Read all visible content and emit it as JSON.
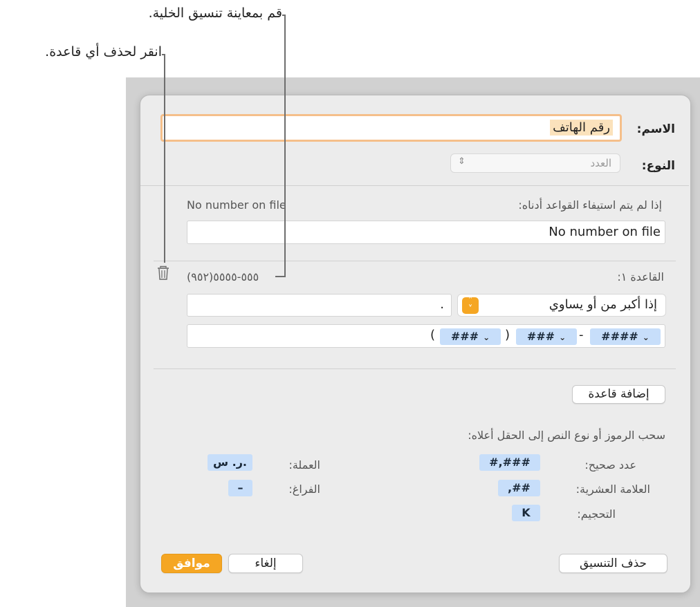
{
  "callouts": {
    "preview": "قم بمعاينة تنسيق الخلية.",
    "delete": "انقر لحذف أي قاعدة."
  },
  "dialog": {
    "name_label": "الاسم:",
    "name_value": "رقم الهاتف",
    "type_label": "النوع:",
    "type_value": "العدد",
    "fallback_label": "إذا لم يتم استيفاء القواعد أدناه:",
    "fallback_preview": "No number on file",
    "fallback_value": "No number on file",
    "rule_label": "القاعدة ١:",
    "rule_preview": "(٩٥٢)٥٥٥-٥٥٥٥",
    "rule_condition": "إذا أكبر من أو يساوي",
    "rule_value": ".",
    "format_tokens": {
      "open_paren": "(",
      "area": "###",
      "close_paren": ")",
      "prefix": "###",
      "dash": "-",
      "line": "####"
    },
    "add_rule_button": "إضافة قاعدة",
    "drag_hint": "سحب الرموز أو نوع النص إلى الحقل أعلاه:",
    "integer_label": "عدد صحيح:",
    "integer_token": "#,###",
    "decimal_label": "العلامة العشرية:",
    "decimal_token": ",##",
    "scale_label": "التحجيم:",
    "scale_token": "K",
    "currency_label": "العملة:",
    "currency_token": "ر. س.",
    "space_label": "الفراغ:",
    "space_token": "–",
    "delete_format_button": "حذف التنسيق",
    "cancel_button": "إلغاء",
    "ok_button": "موافق"
  },
  "colors": {
    "accent": "#f5a623",
    "token_bg": "#c7defa",
    "name_highlight": "#fbe2bc"
  }
}
